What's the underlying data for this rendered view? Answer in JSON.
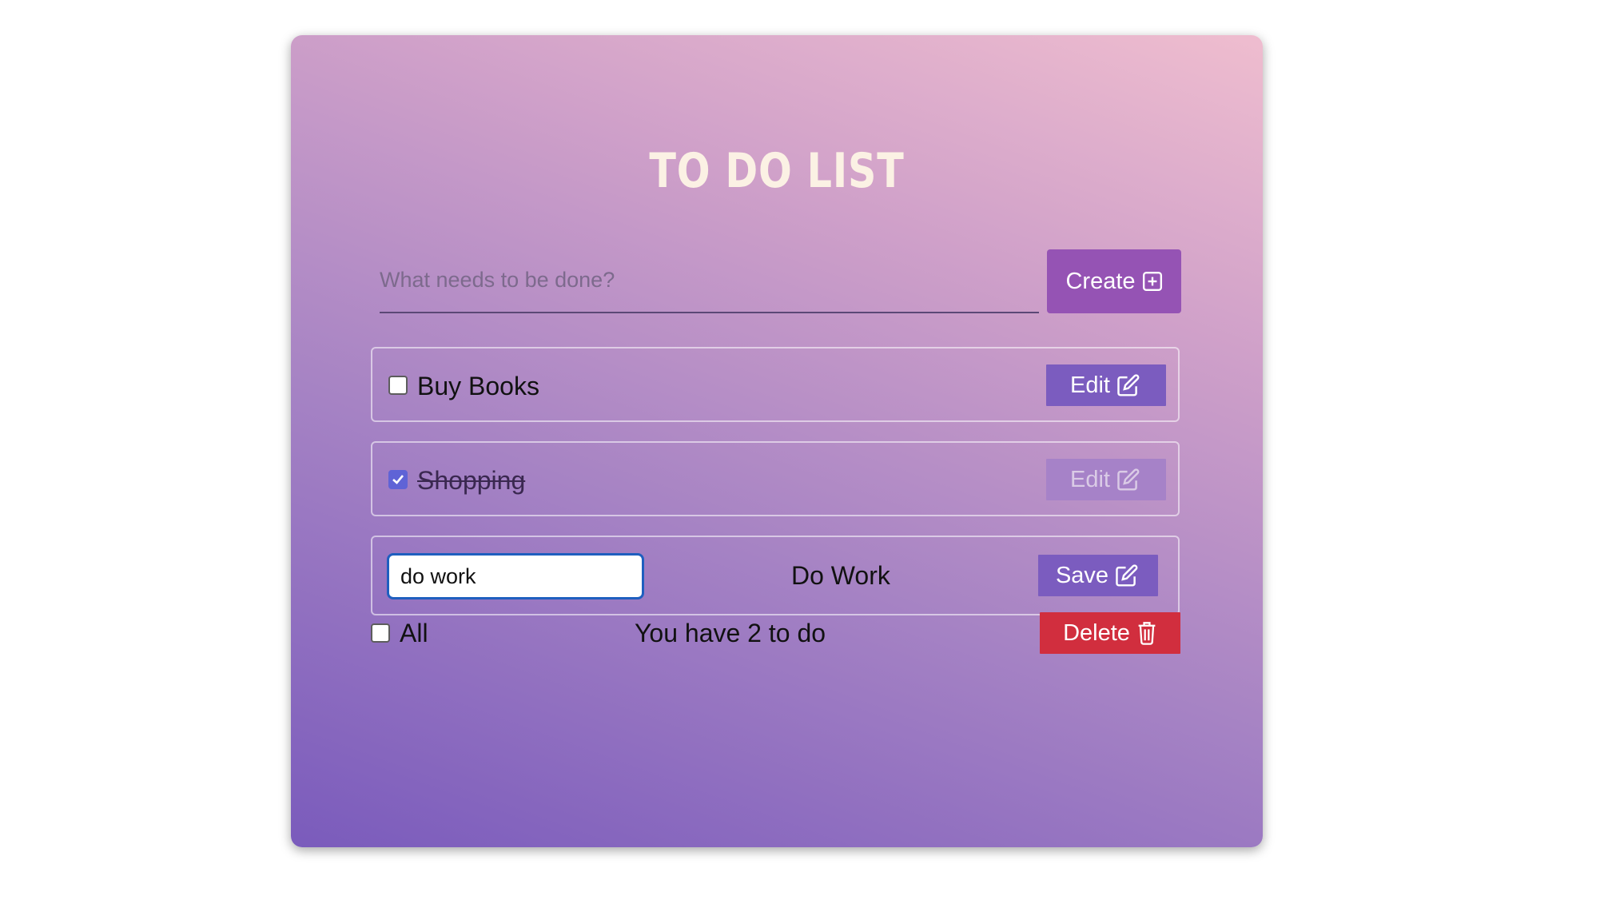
{
  "app": {
    "title": "TO DO LIST"
  },
  "new_todo": {
    "placeholder": "What needs to be done?",
    "value": "",
    "create_label": "Create",
    "create_icon": "plus-square-icon"
  },
  "todos": [
    {
      "label": "Buy Books",
      "completed": false,
      "editing": false,
      "action_label": "Edit",
      "action_icon": "pencil-square-icon"
    },
    {
      "label": "Shopping",
      "completed": true,
      "editing": false,
      "action_label": "Edit",
      "action_icon": "pencil-square-icon",
      "action_disabled": true
    },
    {
      "label": "Do Work",
      "completed": false,
      "editing": true,
      "edit_value": "do work",
      "action_label": "Save",
      "action_icon": "pencil-square-icon"
    }
  ],
  "footer": {
    "select_all_label": "All",
    "select_all_checked": false,
    "remaining_text": "You have 2 to do",
    "delete_label": "Delete",
    "delete_icon": "trash-icon"
  },
  "colors": {
    "gradient_start": "#7a5bbc",
    "gradient_end": "#efbdcf",
    "title": "#fbf1e4",
    "create_button": "#9553b4",
    "edit_button": "#7b5cbf",
    "delete_button": "#d12e3e",
    "checkbox_checked": "#5f63d6",
    "edit_input_focus": "#1f5fbf"
  }
}
